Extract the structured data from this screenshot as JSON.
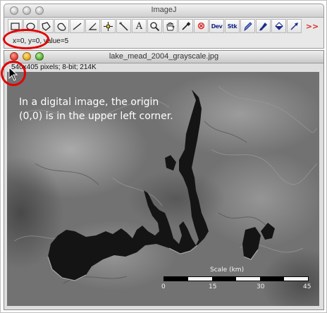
{
  "toolbar_window": {
    "title": "ImageJ",
    "tools": [
      {
        "name": "rectangle-tool-icon"
      },
      {
        "name": "oval-tool-icon"
      },
      {
        "name": "polygon-tool-icon"
      },
      {
        "name": "freehand-tool-icon"
      },
      {
        "name": "line-tool-icon"
      },
      {
        "name": "angle-tool-icon"
      },
      {
        "name": "point-tool-icon"
      },
      {
        "name": "wand-tool-icon"
      },
      {
        "name": "text-tool-icon",
        "label": "A"
      },
      {
        "name": "magnifier-tool-icon"
      },
      {
        "name": "hand-tool-icon"
      },
      {
        "name": "color-picker-icon"
      },
      {
        "name": "remove-overlay-icon",
        "label": "⊗"
      },
      {
        "name": "developer-menu-icon",
        "label": "Dev"
      },
      {
        "name": "stack-tools-icon",
        "label": "Stk"
      },
      {
        "name": "pencil-tool-icon"
      },
      {
        "name": "brush-tool-icon"
      },
      {
        "name": "flood-fill-icon"
      },
      {
        "name": "arrow-tool-icon"
      }
    ],
    "more_tools_label": ">>",
    "status_text": "x=0, y=0, value=5"
  },
  "image_window": {
    "title": "lake_mead_2004_grayscale.jpg",
    "info": "540x405 pixels; 8-bit; 214K",
    "annotation": "In a digital image, the origin (0,0) is in the upper left corner.",
    "scale_bar": {
      "title": "Scale (km)",
      "ticks": [
        "0",
        "15",
        "30",
        "45"
      ]
    }
  },
  "colors": {
    "highlight": "#e30000",
    "close_button": "#e2382b",
    "minimize_button": "#e6a41c",
    "zoom_button": "#4ea92b"
  }
}
